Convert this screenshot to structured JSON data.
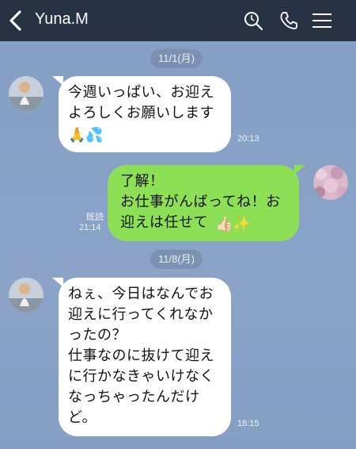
{
  "header": {
    "title": "Yuna.M"
  },
  "messages": [
    {
      "date": "11/1(月)"
    },
    {
      "text": "今週いっぱい、お迎え\nよろしくお願いします",
      "time": "20:13"
    },
    {
      "text": "了解！\nお仕事がんばってね！お\n迎えは任せて",
      "time": "21:14",
      "read": "既読"
    },
    {
      "date": "11/8(月)"
    },
    {
      "text": "ねぇ、今日はなんでお\n迎えに行ってくれなか\nったの？\n仕事なのに抜けて迎え\nに行かなきゃいけなく\nなっちゃったんだけ\nど。",
      "time": "18:15"
    }
  ]
}
